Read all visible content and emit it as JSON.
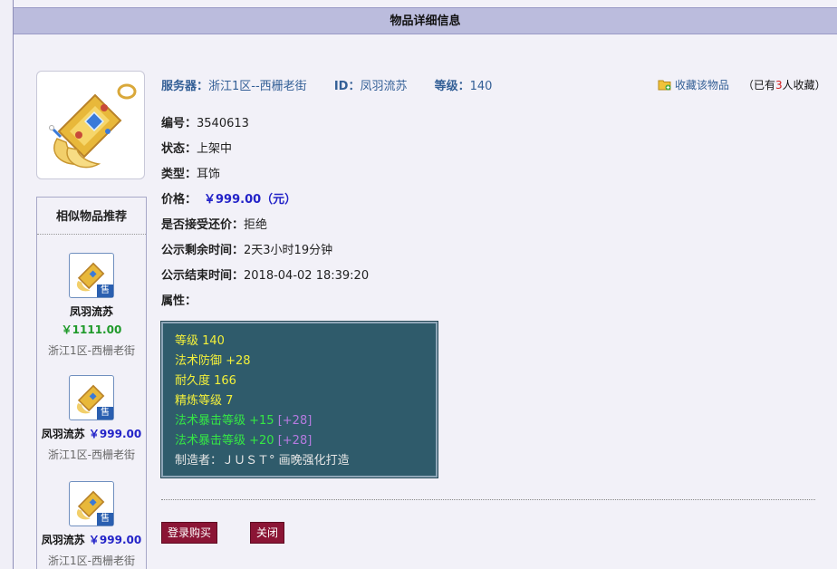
{
  "page": {
    "title": "物品详细信息"
  },
  "item": {
    "server_label": "服务器：",
    "server_value": "浙江1区--西栅老街",
    "id_label": "ID：",
    "id_value": "凤羽流苏",
    "level_label": "等级：",
    "level_value": "140",
    "favorite_label": "收藏该物品",
    "favorite_count_prefix": "（已有",
    "favorite_count": "3",
    "favorite_count_suffix": "人收藏）",
    "fields": [
      {
        "label": "编号：",
        "value": "3540613"
      },
      {
        "label": "状态：",
        "value": "上架中"
      },
      {
        "label": "类型：",
        "value": "耳饰"
      },
      {
        "label": "价格：",
        "value": "￥999.00（元）"
      },
      {
        "label": "是否接受还价：",
        "value": "拒绝"
      },
      {
        "label": "公示剩余时间：",
        "value": "2天3小时19分钟"
      },
      {
        "label": "公示结束时间：",
        "value": "2018-04-02 18:39:20"
      },
      {
        "label": "属性：",
        "value": ""
      }
    ],
    "attributes": [
      {
        "text": "等级 140",
        "extra": ""
      },
      {
        "text": "法术防御 +28",
        "extra": ""
      },
      {
        "text": "耐久度 166",
        "extra": ""
      },
      {
        "text": "精炼等级 7",
        "extra": ""
      },
      {
        "text": "法术暴击等级 +15 ",
        "extra": "[+28]"
      },
      {
        "text": "法术暴击等级 +20 ",
        "extra": "[+28]"
      },
      {
        "text": "制造者：ＪＵＳＴ° 画晚强化打造",
        "extra": ""
      }
    ]
  },
  "similar": {
    "title": "相似物品推荐",
    "sale_badge": "售",
    "items": [
      {
        "name": "凤羽流苏",
        "price": "￥1111.00",
        "server": "浙江1区-西栅老街"
      },
      {
        "name": "凤羽流苏",
        "price": "￥999.00",
        "server": "浙江1区-西栅老街"
      },
      {
        "name": "凤羽流苏",
        "price": "￥999.00",
        "server": "浙江1区-西栅老街"
      }
    ]
  },
  "buttons": {
    "login_buy": "登录购买",
    "close": "关闭"
  },
  "colors": {
    "title_bg": "#bbbcdd",
    "button_bg": "#8b1535",
    "attr_bg": "#2f5b6b",
    "link_blue": "#335f96",
    "price_blue": "#2323c8",
    "price_green": "#1f9a2a"
  },
  "icons": {
    "item": "golden-earring-icon",
    "favorite": "folder-plus-icon"
  }
}
